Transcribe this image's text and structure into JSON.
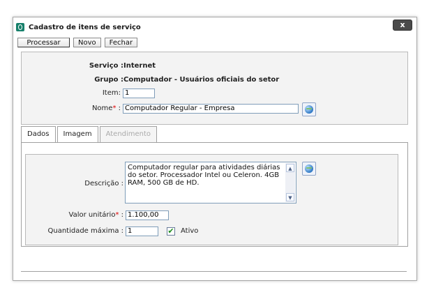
{
  "dialog": {
    "title": "Cadastro de itens de serviço",
    "close_label": "x"
  },
  "toolbar": {
    "processar": "Processar",
    "novo": "Novo",
    "fechar": "Fechar"
  },
  "info": {
    "servico_label": "Serviço :",
    "servico_value": "Internet",
    "grupo_label": "Grupo :",
    "grupo_value": "Computador - Usuários oficiais do setor",
    "item_label": "Item:",
    "item_value": "1",
    "nome_label": "Nome",
    "nome_colon": ":",
    "nome_value": "Computador Regular - Empresa",
    "required_mark": "*"
  },
  "tabs": [
    {
      "label": "Dados"
    },
    {
      "label": "Imagem"
    },
    {
      "label": "Atendimento"
    }
  ],
  "dados": {
    "descricao_label": "Descrição :",
    "descricao_value": "Computador regular para atividades diárias do setor. Processador Intel ou Celeron. 4GB RAM, 500 GB de HD.",
    "valor_label": "Valor unitário",
    "valor_colon": ":",
    "valor_value": "1.100,00",
    "quantidade_label": "Quantidade máxima :",
    "quantidade_value": "1",
    "ativo_label": "Ativo",
    "ativo_checked": true
  },
  "icons": {
    "translate": "globe-icon",
    "checkmark": "✔",
    "scroll_up": "▲",
    "scroll_down": "▼"
  }
}
